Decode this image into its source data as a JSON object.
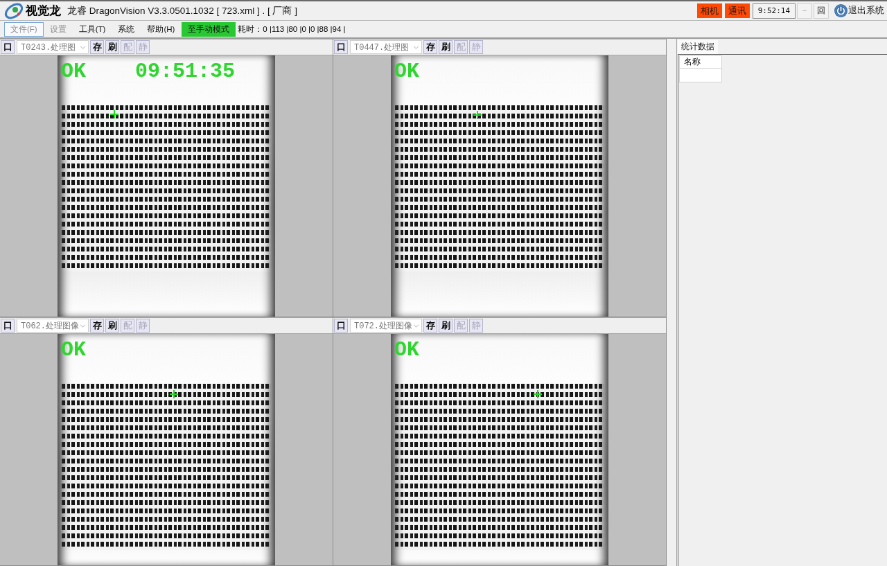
{
  "title_bar": {
    "logo": "视觉龙",
    "title": "龙睿 DragonVision V3.3.0501.1032 [ 723.xml ] . [ 厂商 ]",
    "indicators": [
      {
        "label": "相机",
        "alarm": true
      },
      {
        "label": "通讯",
        "alarm": true
      }
    ],
    "clock": "9:52:14",
    "window_buttons": [
      {
        "label": "－",
        "disabled": true
      },
      {
        "label": "回",
        "disabled": false
      }
    ],
    "exit_button": "退出系统"
  },
  "menu_bar": {
    "items": [
      {
        "label": "文件(F)",
        "selected": true,
        "disabled": true
      },
      {
        "label": "设置",
        "selected": false,
        "disabled": true
      },
      {
        "label": "工具(T)",
        "selected": false,
        "disabled": false
      },
      {
        "label": "系统",
        "selected": false,
        "disabled": false
      },
      {
        "label": "帮助(H)",
        "selected": false,
        "disabled": false
      }
    ],
    "mode_button": "至手动模式",
    "timing": "耗时：0 |113 |80 |0 |0 |88 |94 |"
  },
  "views": [
    {
      "toggle": "口",
      "source": "T0243.处理图",
      "buttons": [
        {
          "label": "存",
          "disabled": false
        },
        {
          "label": "刷",
          "disabled": false
        },
        {
          "label": "配",
          "disabled": true
        },
        {
          "label": "静",
          "disabled": true
        }
      ],
      "result": "OK",
      "timestamp": "09:51:35"
    },
    {
      "toggle": "口",
      "source": "T0447.处理图",
      "buttons": [
        {
          "label": "存",
          "disabled": false
        },
        {
          "label": "刷",
          "disabled": false
        },
        {
          "label": "配",
          "disabled": true
        },
        {
          "label": "静",
          "disabled": true
        }
      ],
      "result": "OK"
    },
    {
      "toggle": "口",
      "source": "T062.处理图像",
      "buttons": [
        {
          "label": "存",
          "disabled": false
        },
        {
          "label": "刷",
          "disabled": false
        },
        {
          "label": "配",
          "disabled": true
        },
        {
          "label": "静",
          "disabled": true
        }
      ],
      "result": "OK"
    },
    {
      "toggle": "口",
      "source": "T072.处理图像",
      "buttons": [
        {
          "label": "存",
          "disabled": false
        },
        {
          "label": "刷",
          "disabled": false
        },
        {
          "label": "配",
          "disabled": true
        },
        {
          "label": "静",
          "disabled": true
        }
      ],
      "result": "OK"
    }
  ],
  "stats_panel": {
    "tab": "统计数据",
    "columns": [
      "名称"
    ]
  }
}
